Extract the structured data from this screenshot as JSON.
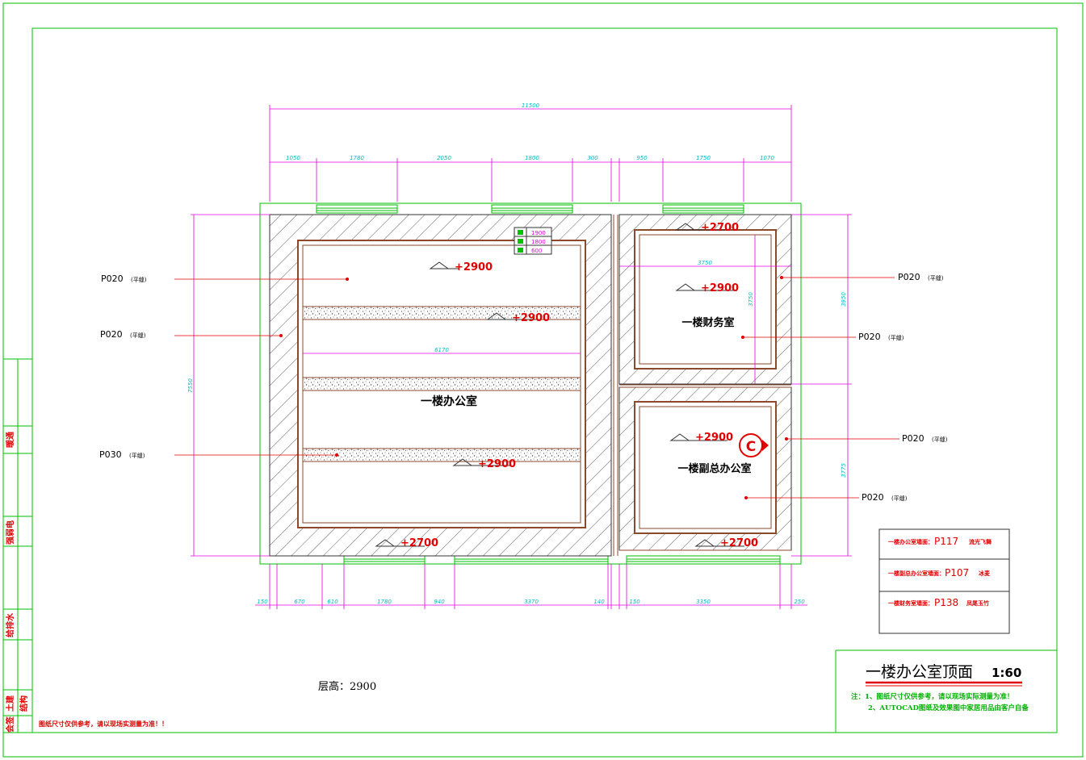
{
  "title": "一楼办公室顶面",
  "scale": "1:60",
  "floor_height_label": "层高：2900",
  "notes": [
    "注：1、图纸尺寸仅供参考，请以现场实际测量为准！",
    "2、AUTOCAD图纸及效果图中家居用品由客户自备"
  ],
  "bottom_warning": "图纸尺寸仅供参考，请以现场实测量为准！！",
  "rooms": [
    {
      "name": "一楼办公室"
    },
    {
      "name": "一楼财务室"
    },
    {
      "name": "一楼副总办公室"
    }
  ],
  "material_tags": [
    {
      "code": "P020",
      "note": "(平缝)"
    },
    {
      "code": "P020",
      "note": "(平缝)"
    },
    {
      "code": "P030",
      "note": "(平缝)"
    },
    {
      "code": "P020",
      "note": "(平缝)"
    },
    {
      "code": "P020",
      "note": "(平缝)"
    },
    {
      "code": "P020",
      "note": "(平缝)"
    },
    {
      "code": "P020",
      "note": "(平缝)"
    }
  ],
  "elevations": [
    "+2900",
    "+2900",
    "+2900",
    "+2700",
    "+2700",
    "+2700",
    "+2900",
    "+2900",
    "+2700"
  ],
  "legend_values": [
    "1900",
    "1800",
    "600"
  ],
  "flooring_legend": [
    {
      "room": "一楼办公室墙面：",
      "code": "P117",
      "desc": "流光飞舞"
    },
    {
      "room": "一楼副总办公室墙面：",
      "code": "P107",
      "desc": "冰麦"
    },
    {
      "room": "一楼财务室墙面：",
      "code": "P138",
      "desc": "凤尾玉竹"
    }
  ],
  "dims_top_total": "11500",
  "dims_top": [
    "1050",
    "1780",
    "2050",
    "1800",
    "300",
    "950",
    "1750",
    "1070"
  ],
  "dims_bottom": [
    "150",
    "670",
    "610",
    "1780",
    "940",
    "3370",
    "140",
    "150",
    "3350",
    "250"
  ],
  "dims_left": "7550",
  "dims_right": [
    "3950",
    "3775"
  ],
  "dims_inner": [
    "6170",
    "3750",
    "3750"
  ],
  "section_marker": "C",
  "title_block": [
    "暖通",
    "强弱电",
    "给排水",
    "土建",
    "结构",
    "会签"
  ],
  "colors": {
    "frame": "#00c000",
    "wall": "#8b4a2b",
    "red": "#e00000",
    "cyan": "#00b8c8",
    "magenta": "#e000e0"
  }
}
